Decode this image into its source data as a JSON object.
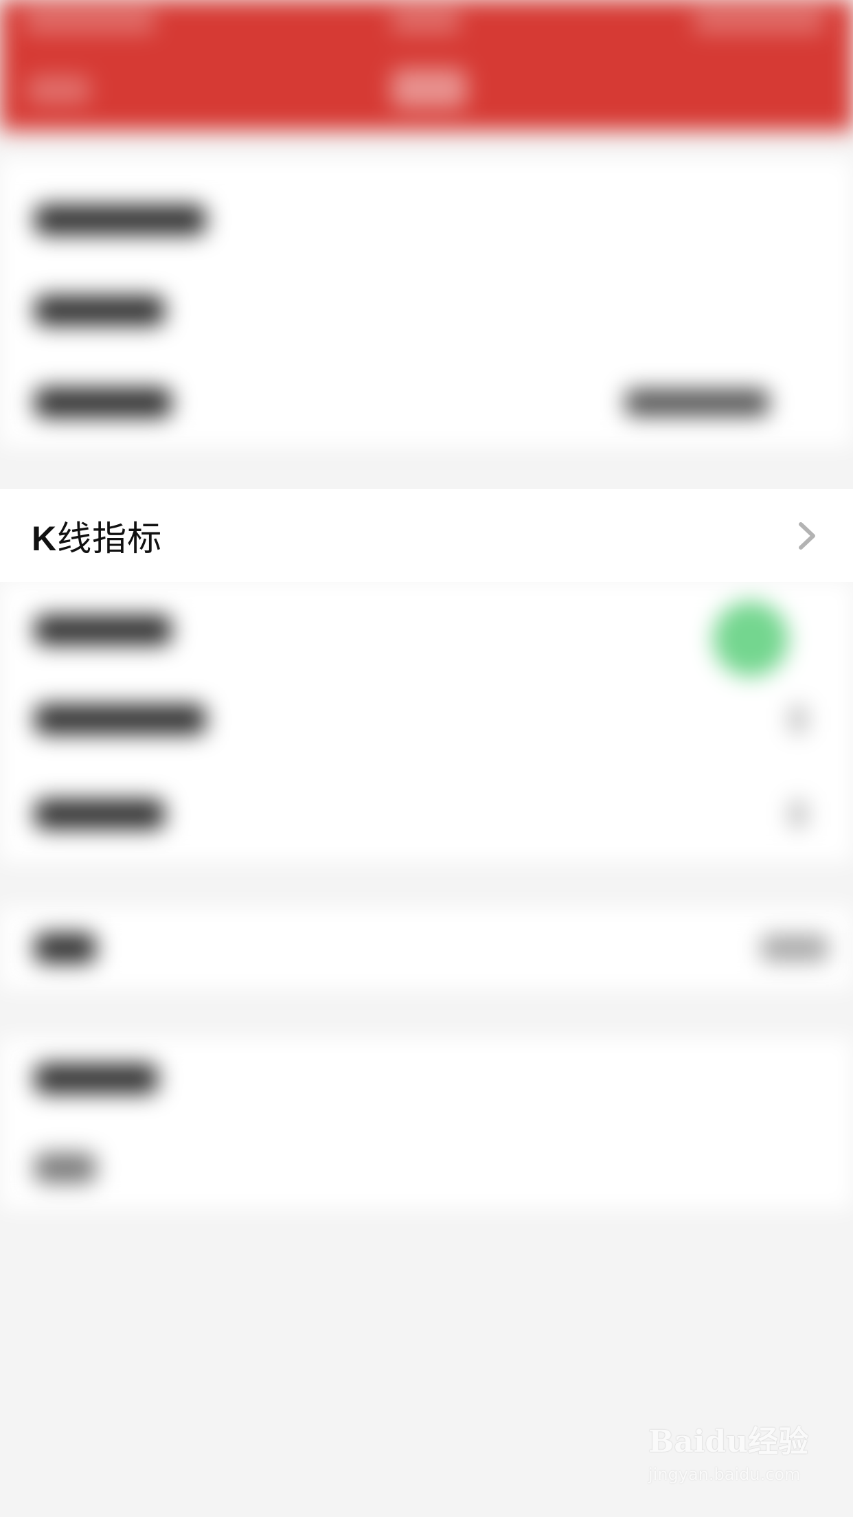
{
  "highlighted_row": {
    "label_prefix": "K",
    "label_rest": "线指标",
    "chevron_icon": "chevron-right-icon"
  },
  "colors": {
    "header_red": "#d63a34",
    "toggle_green": "#74d68f",
    "background": "#f4f4f4",
    "row_white": "#ffffff"
  },
  "watermark": {
    "logo_text": "Baidu经验",
    "url": "jingyan.baidu.com"
  }
}
